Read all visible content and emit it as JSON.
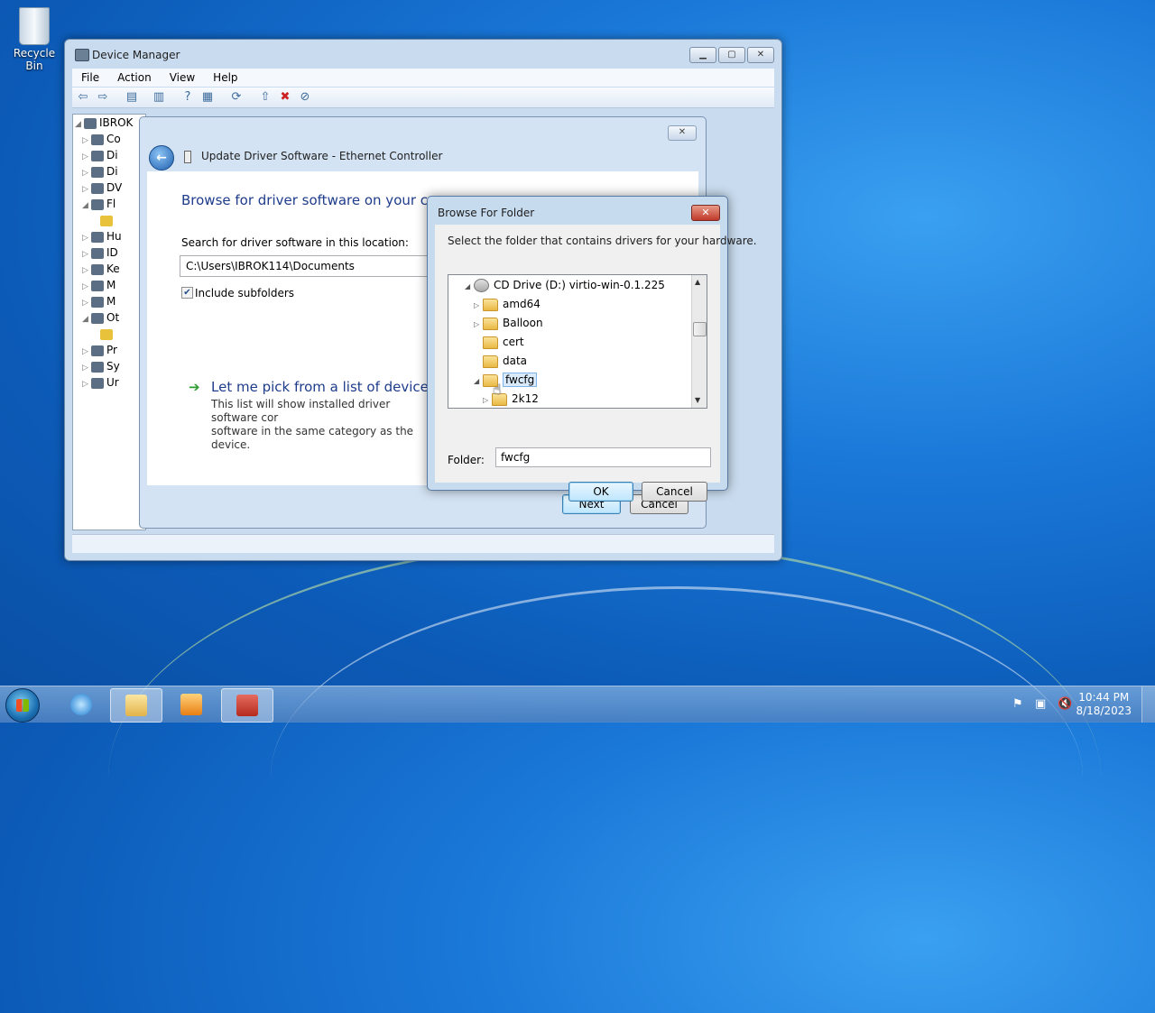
{
  "desktop": {
    "recycle_bin_label": "Recycle Bin"
  },
  "device_manager": {
    "title": "Device Manager",
    "menu": [
      "File",
      "Action",
      "View",
      "Help"
    ],
    "tree_root": "IBROK",
    "tree_items": [
      "Co",
      "Di",
      "Di",
      "DV",
      "Fl",
      "",
      "Hu",
      "ID",
      "Ke",
      "M",
      "M",
      "Ot",
      "",
      "Pr",
      "Sy",
      "Ur"
    ]
  },
  "update_driver": {
    "title": "Update Driver Software - Ethernet Controller",
    "heading": "Browse for driver software on your comp",
    "search_label": "Search for driver software in this location:",
    "path_value": "C:\\Users\\IBROK114\\Documents",
    "include_subfolders": "Include subfolders",
    "include_checked": true,
    "pick_link": "Let me pick from a list of device dri",
    "pick_desc_1": "This list will show installed driver software cor",
    "pick_desc_2": "software in the same category as the device.",
    "next_label": "Next",
    "cancel_label": "Cancel"
  },
  "browse_folder": {
    "title": "Browse For Folder",
    "instruction": "Select the folder that contains drivers for your hardware.",
    "tree": [
      {
        "label": "CD Drive (D:) virtio-win-0.1.225",
        "type": "drive",
        "expander": "◢"
      },
      {
        "label": "amd64",
        "type": "folder",
        "expander": "▷"
      },
      {
        "label": "Balloon",
        "type": "folder",
        "expander": "▷"
      },
      {
        "label": "cert",
        "type": "folder",
        "expander": ""
      },
      {
        "label": "data",
        "type": "folder",
        "expander": ""
      },
      {
        "label": "fwcfg",
        "type": "folder",
        "expander": "◢",
        "selected": true
      },
      {
        "label": "2k12",
        "type": "folder",
        "expander": "▷"
      }
    ],
    "folder_label": "Folder:",
    "folder_value": "fwcfg",
    "ok_label": "OK",
    "cancel_label": "Cancel"
  },
  "taskbar": {
    "time": "10:44 PM",
    "date": "8/18/2023",
    "apps": [
      "internet-explorer",
      "file-explorer",
      "media-player",
      "device-manager"
    ]
  }
}
